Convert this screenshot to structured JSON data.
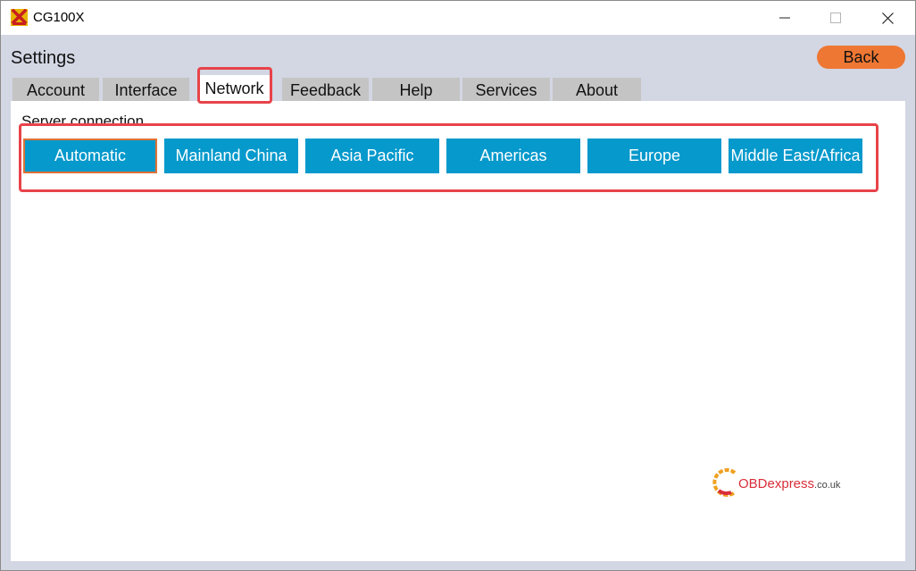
{
  "window": {
    "title": "CG100X",
    "icon": "app-x-logo-icon",
    "controls": [
      "minimize-icon",
      "maximize-icon",
      "close-icon"
    ]
  },
  "page": {
    "title": "Settings"
  },
  "header": {
    "back_label": "Back"
  },
  "tabs": [
    {
      "label": "Account",
      "active": false
    },
    {
      "label": "Interface",
      "active": false
    },
    {
      "label": "Network",
      "active": true
    },
    {
      "label": "Feedback",
      "active": false
    },
    {
      "label": "Help",
      "active": false
    },
    {
      "label": "Services",
      "active": false
    },
    {
      "label": "About",
      "active": false
    }
  ],
  "network": {
    "section_label": "Server connection",
    "servers": [
      {
        "label": "Automatic",
        "selected": true
      },
      {
        "label": "Mainland China",
        "selected": false
      },
      {
        "label": "Asia Pacific",
        "selected": false
      },
      {
        "label": "Americas",
        "selected": false
      },
      {
        "label": "Europe",
        "selected": false
      },
      {
        "label": "Middle East/Africa",
        "selected": false
      }
    ]
  },
  "watermark": {
    "brand": "OBDexpress",
    "suffix": ".co.uk"
  },
  "colors": {
    "accent": "#0599cc",
    "back_button": "#ee7733",
    "annotation": "#e8434a",
    "background": "#d3d6e3"
  }
}
